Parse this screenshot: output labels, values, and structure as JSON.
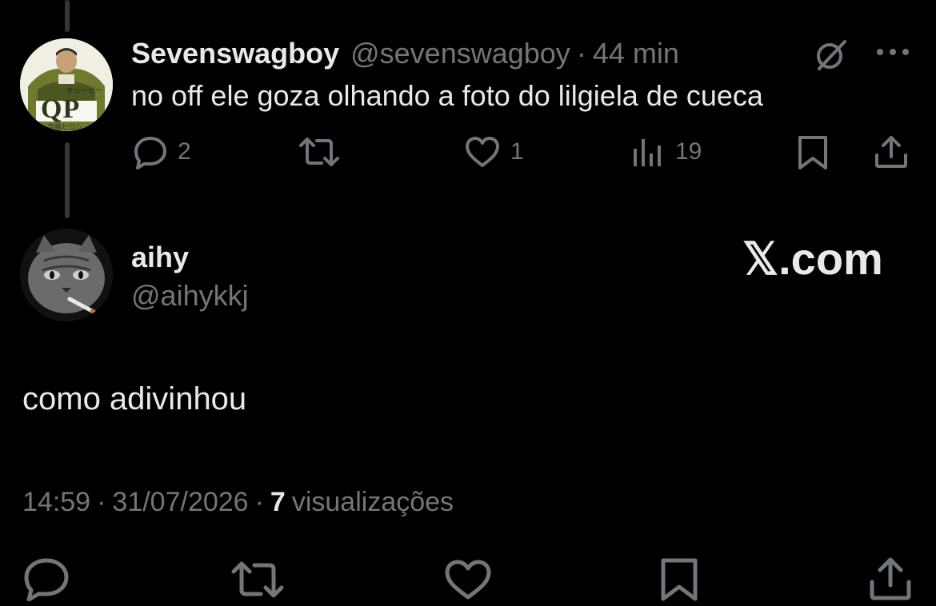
{
  "parent_tweet": {
    "display_name": "Sevenswagboy",
    "handle": "@sevenswagboy",
    "separator": "·",
    "time_ago": "44 min",
    "text": "no off ele goza olhando a foto do lilgiela de cueca",
    "avatar_text": {
      "big": "QP",
      "small": "高橋ヒロシ",
      "top": "キューピー"
    },
    "actions": {
      "replies": "2",
      "reposts": "",
      "likes": "1",
      "views": "19"
    }
  },
  "reply_tweet": {
    "display_name": "aihy",
    "handle": "@aihykkj",
    "text": "como adivinhou",
    "time": "14:59",
    "date": "31/07/2026",
    "sep": "·",
    "views_count": "7",
    "views_label": "visualizações"
  },
  "watermark": "𝕏.com",
  "colors": {
    "background": "#000000",
    "text": "#e7e9ea",
    "muted": "#71767b",
    "thread_line": "#333639"
  }
}
